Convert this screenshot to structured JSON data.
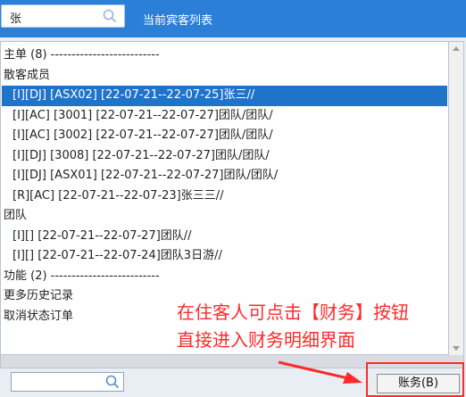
{
  "header": {
    "search_value": "张",
    "title": "当前宾客列表"
  },
  "list": [
    {
      "text": "主单 (8) --------------------------",
      "indent": false,
      "selected": false
    },
    {
      "text": "散客成员",
      "indent": false,
      "selected": false
    },
    {
      "text": "[I][DJ] [ASX02] [22-07-21--22-07-25]张三//",
      "indent": true,
      "selected": true
    },
    {
      "text": "[I][AC] [3001] [22-07-21--22-07-27]团队/团队/",
      "indent": true,
      "selected": false
    },
    {
      "text": "[I][AC] [3002] [22-07-21--22-07-27]团队/团队/",
      "indent": true,
      "selected": false
    },
    {
      "text": "[I][DJ] [3008] [22-07-21--22-07-27]团队/团队/",
      "indent": true,
      "selected": false
    },
    {
      "text": "[I][DJ] [ASX01] [22-07-21--22-07-27]团队/团队/",
      "indent": true,
      "selected": false
    },
    {
      "text": "[R][AC] [22-07-21--22-07-23]张三三//",
      "indent": true,
      "selected": false
    },
    {
      "text": "团队",
      "indent": false,
      "selected": false
    },
    {
      "text": "[I][] [22-07-21--22-07-27]团队//",
      "indent": true,
      "selected": false
    },
    {
      "text": "[I][] [22-07-21--22-07-24]团队3日游//",
      "indent": true,
      "selected": false
    },
    {
      "text": "功能 (2) --------------------------",
      "indent": false,
      "selected": false
    },
    {
      "text": "更多历史记录",
      "indent": false,
      "selected": false
    },
    {
      "text": "取消状态订单",
      "indent": false,
      "selected": false
    }
  ],
  "annotation": {
    "line1": "在住客人可点击【财务】按钮",
    "line2": "直接进入财务明细界面"
  },
  "footer": {
    "search_value": "",
    "finance_button_label": "账务(B)"
  },
  "colors": {
    "header_bg": "#2c7fd6",
    "selected_row_bg": "#1f73c9",
    "annotation": "#ff2a2a"
  }
}
